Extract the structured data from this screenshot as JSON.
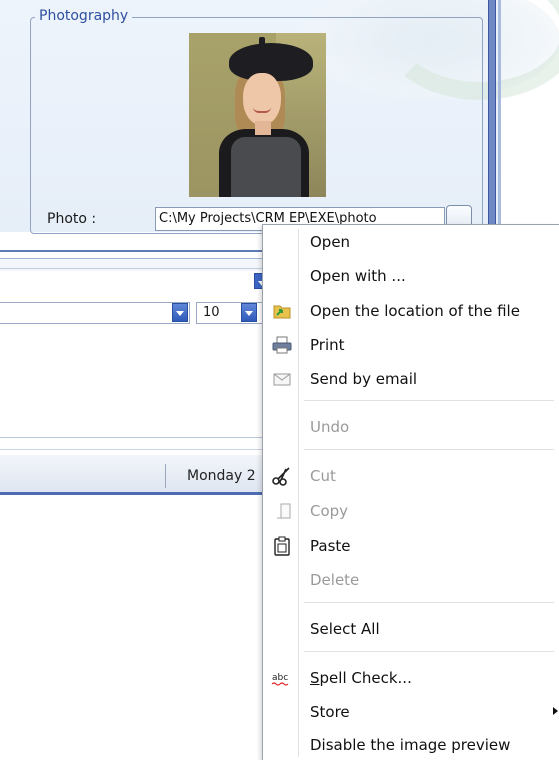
{
  "photography": {
    "legend": "Photography",
    "photo_label": "Photo :",
    "photo_path": "C:\\My Projects\\CRM EP\\EXE\\photo",
    "photo_alt": "Portrait photo"
  },
  "form": {
    "size_value": "10"
  },
  "status": {
    "date_text": "Monday 2"
  },
  "context_menu": {
    "items": [
      {
        "label": "Open",
        "enabled": true,
        "icon": null
      },
      {
        "label": "Open with ...",
        "enabled": true,
        "icon": null
      },
      {
        "label": "Open the location of the file",
        "enabled": true,
        "icon": "folder-arrow-icon"
      },
      {
        "label": "Print",
        "enabled": true,
        "icon": "printer-icon"
      },
      {
        "label": "Send by email",
        "enabled": true,
        "icon": "envelope-icon"
      },
      {
        "label": "Undo",
        "enabled": false,
        "icon": null
      },
      {
        "label": "Cut",
        "enabled": false,
        "icon": "scissors-icon"
      },
      {
        "label": "Copy",
        "enabled": false,
        "icon": "copy-icon"
      },
      {
        "label": "Paste",
        "enabled": true,
        "icon": "paste-icon"
      },
      {
        "label": "Delete",
        "enabled": false,
        "icon": null
      },
      {
        "label": "Select All",
        "enabled": true,
        "icon": null
      },
      {
        "label_prefix": "S",
        "label_rest": "pell Check...",
        "enabled": true,
        "icon": "spellcheck-icon"
      },
      {
        "label": "Store",
        "enabled": true,
        "icon": null,
        "has_submenu": true
      },
      {
        "label": "Disable the image preview",
        "enabled": true,
        "icon": null
      }
    ]
  },
  "colors": {
    "accent": "#3d66c4",
    "legend_text": "#2f4f9f",
    "disabled_text": "#9a9a9a"
  }
}
